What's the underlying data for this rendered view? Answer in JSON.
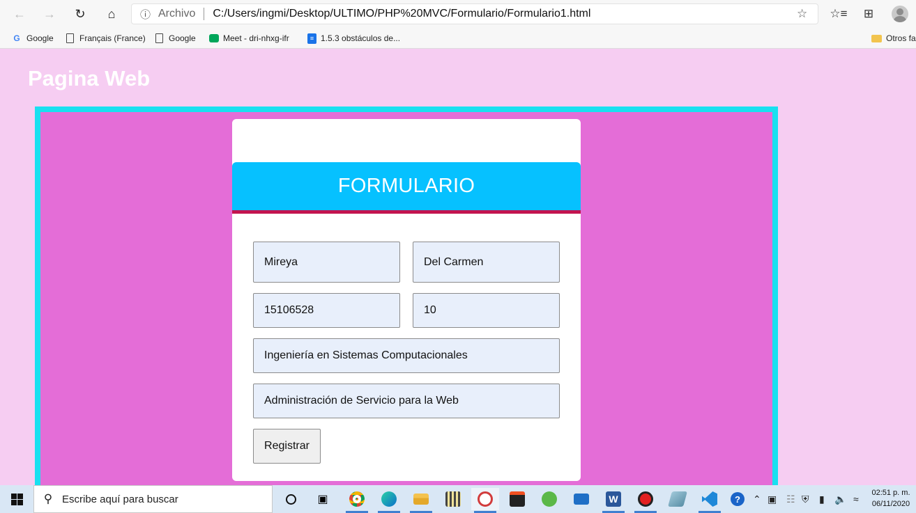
{
  "browser": {
    "address_label": "Archivo",
    "url": "C:/Users/ingmi/Desktop/ULTIMO/PHP%20MVC/Formulario/Formulario1.html",
    "bookmarks": [
      {
        "label": "Google",
        "icon": "google-icon"
      },
      {
        "label": "Français (France)",
        "icon": "document-icon"
      },
      {
        "label": "Google",
        "icon": "document-icon"
      },
      {
        "label": "Meet - dri-nhxg-ifr",
        "icon": "meet-icon"
      },
      {
        "label": "1.5.3 obstáculos de...",
        "icon": "docs-icon"
      }
    ],
    "other_favorites": "Otros fa"
  },
  "page": {
    "title": "Pagina Web"
  },
  "form": {
    "header": "FORMULARIO",
    "fields": {
      "nombre": "Mireya",
      "apellido": "Del Carmen",
      "matricula": "15106528",
      "semestre": "10",
      "carrera": "Ingeniería en Sistemas Computacionales",
      "materia": "Administración de Servicio para la Web"
    },
    "submit_label": "Registrar"
  },
  "taskbar": {
    "search_placeholder": "Escribe aquí para buscar",
    "time": "02:51 p. m.",
    "date": "06/11/2020"
  },
  "colors": {
    "page_background": "#f6cdf2",
    "frame_fill": "#e46dd7",
    "frame_border": "#19e0f0",
    "form_header": "#06c1ff",
    "form_header_rule": "#c2144f",
    "input_fill": "#e8effb"
  }
}
